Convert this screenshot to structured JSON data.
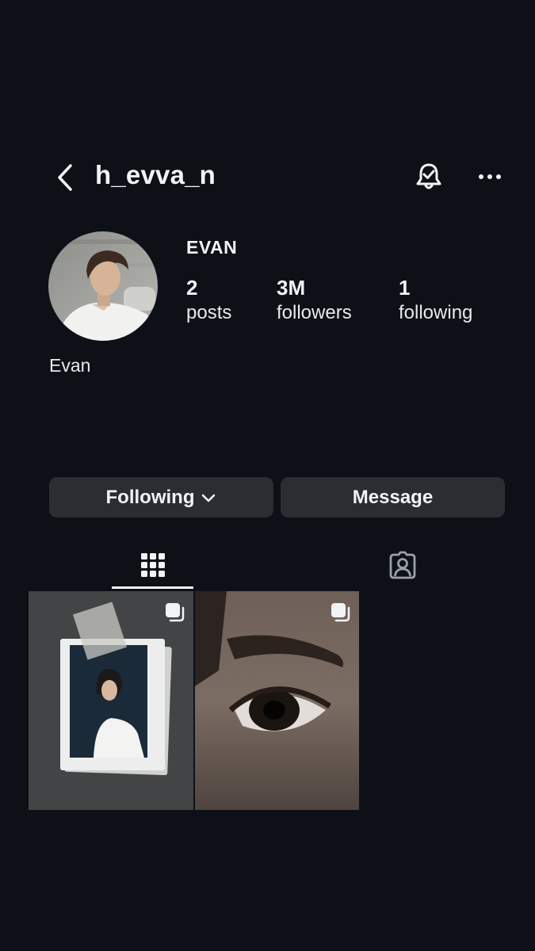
{
  "header": {
    "username": "h_evva_n",
    "back_icon": "chevron-left-icon",
    "bell_icon": "bell-check-icon",
    "more_icon": "more-horizontal-icon"
  },
  "profile": {
    "display_name": "EVAN",
    "bio": "Evan",
    "stats": {
      "posts": {
        "value": "2",
        "label": "posts"
      },
      "followers": {
        "value": "3M",
        "label": "followers"
      },
      "following": {
        "value": "1",
        "label": "following"
      }
    }
  },
  "actions": {
    "following_label": "Following",
    "message_label": "Message"
  },
  "tabs": {
    "grid_icon": "grid-icon",
    "tagged_icon": "tagged-person-icon"
  },
  "posts": [
    {
      "type": "polaroid-photo",
      "multi_icon": "multiple-images-icon"
    },
    {
      "type": "eye-closeup-photo",
      "multi_icon": "multiple-images-icon"
    }
  ],
  "colors": {
    "background": "#0d1117",
    "button": "#2a2e33",
    "text": "#f2f3f5"
  }
}
